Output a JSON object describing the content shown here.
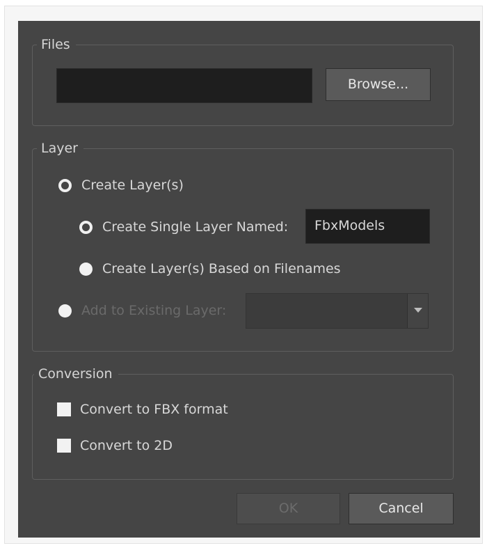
{
  "files": {
    "group_label": "Files",
    "path_value": "",
    "browse_label": "Browse..."
  },
  "layer": {
    "group_label": "Layer",
    "create_layers_label": "Create Layer(s)",
    "create_single_label": "Create Single Layer Named:",
    "single_layer_name": "FbxModels",
    "create_based_label": "Create Layer(s) Based on Filenames",
    "add_existing_label": "Add to Existing Layer:",
    "existing_layer_value": ""
  },
  "conversion": {
    "group_label": "Conversion",
    "fbx_label": "Convert to FBX format",
    "twod_label": "Convert to 2D"
  },
  "footer": {
    "ok_label": "OK",
    "cancel_label": "Cancel"
  }
}
